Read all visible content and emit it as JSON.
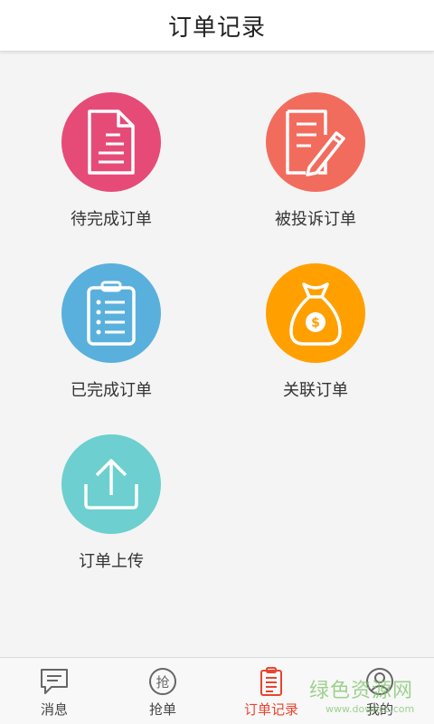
{
  "header": {
    "title": "订单记录"
  },
  "tiles": [
    {
      "label": "待完成订单",
      "color": "#e64b78",
      "icon": "document-icon"
    },
    {
      "label": "被投诉订单",
      "color": "#f26c5e",
      "icon": "edit-document-icon"
    },
    {
      "label": "已完成订单",
      "color": "#5ab0dd",
      "icon": "clipboard-list-icon"
    },
    {
      "label": "关联订单",
      "color": "#ffa000",
      "icon": "money-bag-icon"
    },
    {
      "label": "订单上传",
      "color": "#6dcfcf",
      "icon": "upload-icon"
    }
  ],
  "tabbar": {
    "active_color": "#e8452f",
    "items": [
      {
        "label": "消息",
        "icon": "message-icon"
      },
      {
        "label": "抢单",
        "icon": "grab-order-icon",
        "glyph": "抢"
      },
      {
        "label": "订单记录",
        "icon": "order-record-icon",
        "active": true
      },
      {
        "label": "我的",
        "icon": "user-icon"
      }
    ]
  },
  "watermark": {
    "main": "绿色资源网",
    "sub": "www.downcc.com"
  }
}
